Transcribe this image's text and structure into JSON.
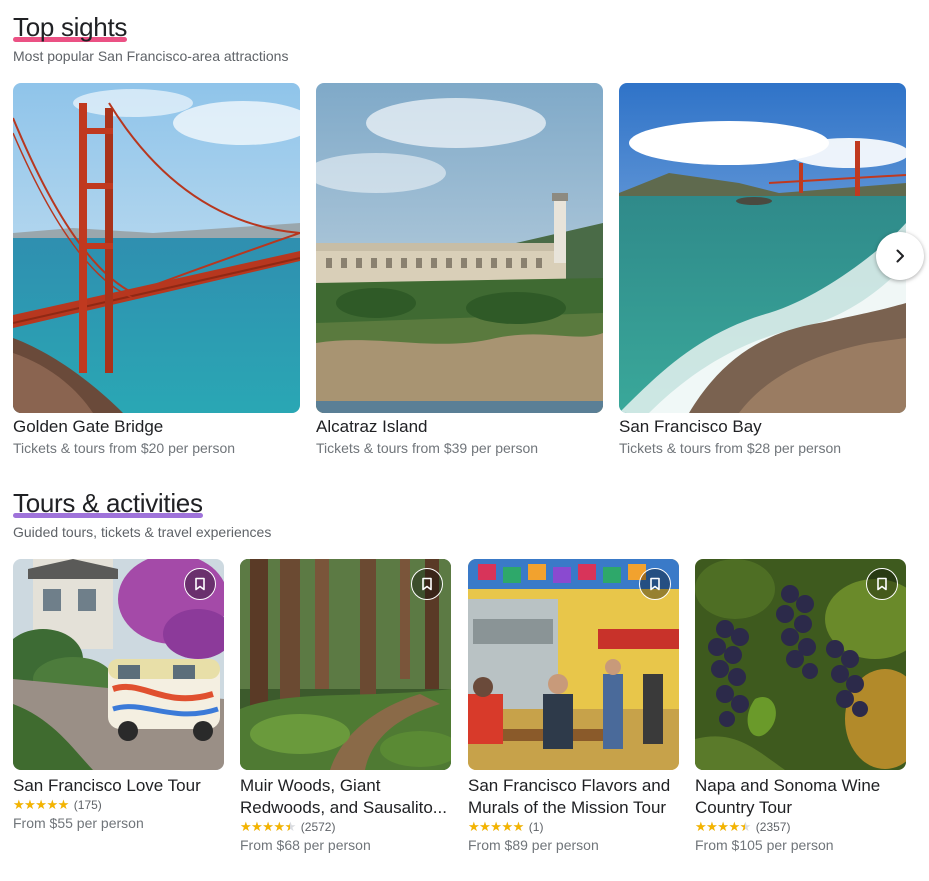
{
  "top_sights": {
    "title": "Top sights",
    "title_underline_color": "#e8336f",
    "subtitle": "Most popular San Francisco-area attractions",
    "cards": [
      {
        "name": "Golden Gate Bridge",
        "meta": "Tickets & tours from $20 per person",
        "image": "golden-gate-bridge-photo"
      },
      {
        "name": "Alcatraz Island",
        "meta": "Tickets & tours from $39 per person",
        "image": "alcatraz-island-photo"
      },
      {
        "name": "San Francisco Bay",
        "meta": "Tickets & tours from $28 per person",
        "image": "san-francisco-bay-photo"
      }
    ],
    "next_icon": "chevron-right-icon"
  },
  "tours": {
    "title": "Tours & activities",
    "title_underline_color": "#8e5bd4",
    "subtitle": "Guided tours, tickets & travel experiences",
    "save_icon": "bookmark-icon",
    "star_color": "#f4b400",
    "cards": [
      {
        "name": "San Francisco Love Tour",
        "rating": 5.0,
        "reviews": "(175)",
        "price": "From $55 per person",
        "image": "love-tour-van-photo"
      },
      {
        "name": "Muir Woods, Giant Redwoods, and Sausalito...",
        "rating": 4.5,
        "reviews": "(2572)",
        "price": "From $68 per person",
        "image": "redwood-forest-photo"
      },
      {
        "name": "San Francisco Flavors and Murals of the Mission Tour",
        "rating": 5.0,
        "reviews": "(1)",
        "price": "From $89 per person",
        "image": "mission-taqueria-photo"
      },
      {
        "name": "Napa and Sonoma Wine Country Tour",
        "rating": 4.5,
        "reviews": "(2357)",
        "price": "From $105 per person",
        "image": "wine-grapes-photo"
      }
    ]
  }
}
